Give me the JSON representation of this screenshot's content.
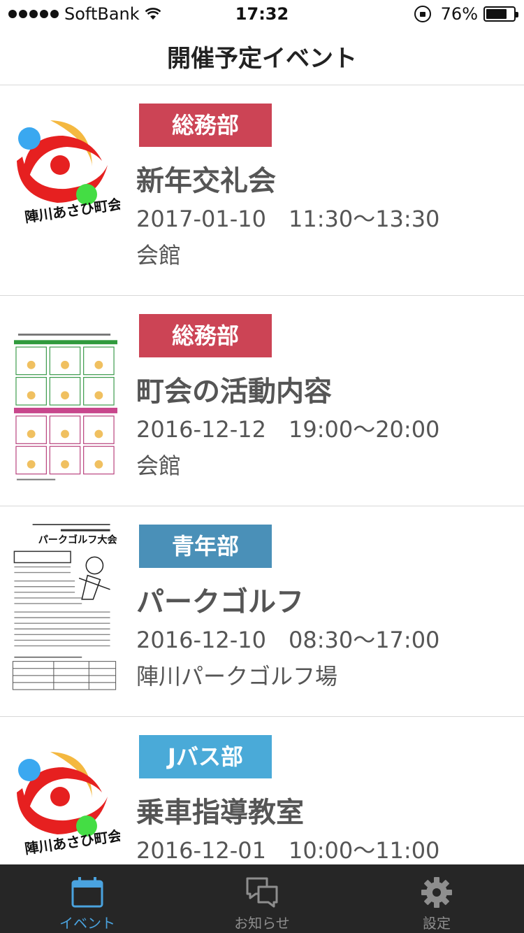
{
  "status_bar": {
    "carrier": "SoftBank",
    "time": "17:32",
    "battery_percent": "76%",
    "battery_level": 0.76
  },
  "nav": {
    "title": "開催予定イベント"
  },
  "events": [
    {
      "department": "総務部",
      "department_color": "#cc4455",
      "title": "新年交礼会",
      "datetime": "2017-01-10　11:30〜13:30",
      "place": "会館",
      "thumbnail": "town-association-logo",
      "logo_text": "陣川あさひ町会"
    },
    {
      "department": "総務部",
      "department_color": "#cc4455",
      "title": "町会の活動内容",
      "datetime": "2016-12-12　19:00〜20:00",
      "place": "会館",
      "thumbnail": "activity-flyer"
    },
    {
      "department": "青年部",
      "department_color": "#4a90b8",
      "title": "パークゴルフ",
      "datetime": "2016-12-10　08:30〜17:00",
      "place": "陣川パークゴルフ場",
      "thumbnail": "park-golf-flyer",
      "flyer_heading": "パークゴルフ大会"
    },
    {
      "department": "Jバス部",
      "department_color": "#4aaad8",
      "title": "乗車指導教室",
      "datetime": "2016-12-01　10:00〜11:00",
      "place": "",
      "thumbnail": "town-association-logo",
      "logo_text": "陣川あさひ町会"
    }
  ],
  "tabs": [
    {
      "label": "イベント",
      "icon": "calendar-icon",
      "active": true
    },
    {
      "label": "お知らせ",
      "icon": "chat-bubbles-icon",
      "active": false
    },
    {
      "label": "設定",
      "icon": "gear-icon",
      "active": false
    }
  ],
  "colors": {
    "accent": "#4aa3df",
    "tab_bar": "#262626"
  }
}
